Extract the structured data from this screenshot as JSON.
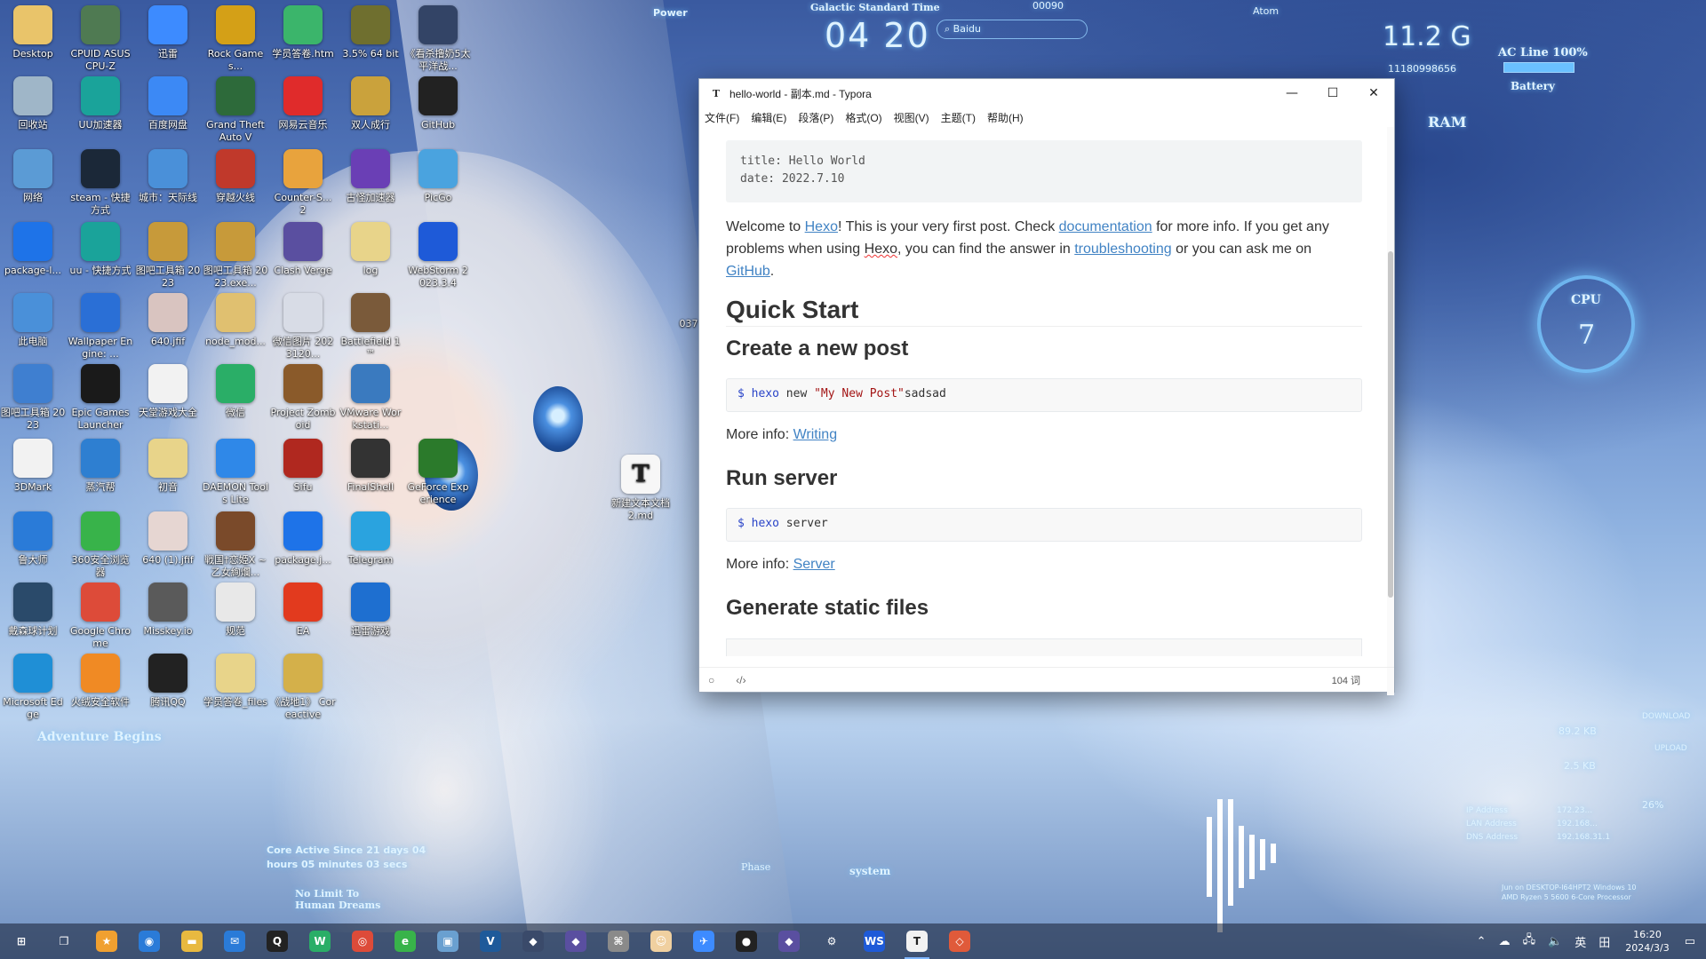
{
  "desktop_icons": [
    {
      "label": "Desktop",
      "color": "#e9c46a"
    },
    {
      "label": "CPUID ASUS CPU-Z",
      "color": "#4f7a52"
    },
    {
      "label": "迅雷",
      "color": "#3d8bff"
    },
    {
      "label": "Rock Games...",
      "color": "#d4a017"
    },
    {
      "label": "学员答卷.htm",
      "color": "#3bb56b"
    },
    {
      "label": "3.5% 64 bit",
      "color": "#6f6f2f"
    },
    {
      "label": "《看杀撸奶5太平洋战...",
      "color": "#334466"
    },
    {
      "label": "回收站",
      "color": "#9fb6c8"
    },
    {
      "label": "UU加速器",
      "color": "#1aa39a"
    },
    {
      "label": "百度网盘",
      "color": "#3c89f5"
    },
    {
      "label": "Grand Theft Auto V",
      "color": "#2d6a3a"
    },
    {
      "label": "网易云音乐",
      "color": "#e02b2b"
    },
    {
      "label": "双人成行",
      "color": "#caa23c"
    },
    {
      "label": "GitHub",
      "color": "#222222"
    },
    {
      "label": "网络",
      "color": "#5b9bd5"
    },
    {
      "label": "steam - 快捷方式",
      "color": "#1b2838"
    },
    {
      "label": "城市：天际线",
      "color": "#4a90d9"
    },
    {
      "label": "穿越火线",
      "color": "#c0392b"
    },
    {
      "label": "Counter-S... 2",
      "color": "#e8a33d"
    },
    {
      "label": "古怪加速器",
      "color": "#6a3fb5"
    },
    {
      "label": "PicGo",
      "color": "#4aa3df"
    },
    {
      "label": "package-l...",
      "color": "#1e73e8"
    },
    {
      "label": "uu - 快捷方式",
      "color": "#1aa39a"
    },
    {
      "label": "图吧工具箱 2023",
      "color": "#c79a3a"
    },
    {
      "label": "图吧工具箱 2023.exe...",
      "color": "#c79a3a"
    },
    {
      "label": "Clash Verge",
      "color": "#5a4fa0"
    },
    {
      "label": "log",
      "color": "#e8d48a"
    },
    {
      "label": "WebStorm 2023.3.4",
      "color": "#1e5ad8"
    },
    {
      "label": "此电脑",
      "color": "#4a90d9"
    },
    {
      "label": "Wallpaper Engine: ...",
      "color": "#2a6fd6"
    },
    {
      "label": "640.jfif",
      "color": "#d9c4c0"
    },
    {
      "label": "node_mod...",
      "color": "#e0c070"
    },
    {
      "label": "微信图片 2023120...",
      "color": "#d8dce6"
    },
    {
      "label": "Battlefield 1 ™",
      "color": "#7a5a3a"
    },
    {
      "label": "",
      "color": "transparent"
    },
    {
      "label": "图吧工具箱 2023",
      "color": "#3f7fd0"
    },
    {
      "label": "Epic Games Launcher",
      "color": "#1a1a1a"
    },
    {
      "label": "天堂游戏大全",
      "color": "#f2f2f2"
    },
    {
      "label": "微信",
      "color": "#2aae67"
    },
    {
      "label": "Project Zomboid",
      "color": "#8a5a2a"
    },
    {
      "label": "VMware Workstati...",
      "color": "#3a7abf"
    },
    {
      "label": "",
      "color": "transparent"
    },
    {
      "label": "3DMark",
      "color": "#f2f2f2"
    },
    {
      "label": "蒸汽帮",
      "color": "#2e7fd1"
    },
    {
      "label": "初音",
      "color": "#e8d48a"
    },
    {
      "label": "DAEMON Tools Lite",
      "color": "#2f88e8"
    },
    {
      "label": "Sifu",
      "color": "#b0281f"
    },
    {
      "label": "FinalShell",
      "color": "#333333"
    },
    {
      "label": "GeForce Experience",
      "color": "#2b7a2b"
    },
    {
      "label": "鲁大师",
      "color": "#2a7bd8"
    },
    {
      "label": "360安全浏览器",
      "color": "#38b34a"
    },
    {
      "label": "640 (1).jfif",
      "color": "#e6d6d2"
    },
    {
      "label": "戦国†恋姫X ~乙女絢爛...",
      "color": "#7a4a2a"
    },
    {
      "label": "package.j...",
      "color": "#1e73e8"
    },
    {
      "label": "Telegram",
      "color": "#2aa3df"
    },
    {
      "label": "",
      "color": "transparent"
    },
    {
      "label": "戴森球计划",
      "color": "#2a4a6a"
    },
    {
      "label": "Google Chrome",
      "color": "#dd4b39"
    },
    {
      "label": "Misskey.io",
      "color": "#5a5a5a"
    },
    {
      "label": "规范",
      "color": "#e8e8e8"
    },
    {
      "label": "EA",
      "color": "#e23a1e"
    },
    {
      "label": "迅雷游戏",
      "color": "#1e6fd0"
    },
    {
      "label": "",
      "color": "transparent"
    },
    {
      "label": "Microsoft Edge",
      "color": "#1f8fd6"
    },
    {
      "label": "火绒安全软件",
      "color": "#f08a24"
    },
    {
      "label": "腾讯QQ",
      "color": "#222222"
    },
    {
      "label": "学员答卷_files",
      "color": "#e8d48a"
    },
    {
      "label": "《战地1》 Coreactive",
      "color": "#d4b04a"
    },
    {
      "label": "",
      "color": "transparent"
    },
    {
      "label": "",
      "color": "transparent"
    }
  ],
  "desktop_file_typora": {
    "label": "新建文本文档 2.md",
    "icon": "T"
  },
  "desktop_partial_label": "037",
  "hud": {
    "power_label": "Power",
    "time_label": "Galactic Standard Time",
    "time_value": "04 20",
    "search_placeholder": "Baidu",
    "counter_value": "00090",
    "atom_label": "Atom",
    "memory_value": "11.2 G",
    "memory_sub": "11180998656",
    "ram_label": "RAM",
    "ac_line": "AC Line 100%",
    "battery_label": "Battery",
    "cpu_label": "CPU",
    "cpu_value": "7",
    "download_label": "DOWNLOAD",
    "download_value": "89.2 KB",
    "upload_label": "UPLOAD",
    "upload_value": "2.5 KB",
    "percent_value": "26%",
    "ip_label": "IP Address",
    "ip_value": "172.23...",
    "lan_label": "LAN Address",
    "lan_value": "192.168...",
    "dns_label": "DNS Address",
    "dns_value": "192.168.31.1",
    "system_label": "system",
    "phase_label": "Phase",
    "core_active": "Core Active Since 21 days 04 hours 05 minutes 03 secs",
    "adventure": "Adventure Begins",
    "no_limit": "No Limit To Human Dreams",
    "sys_info": "Jun on DESKTOP-I64HPT2 Windows 10 AMD Ryzen 5 5600 6-Core Processor"
  },
  "typora": {
    "title": "hello-world - 副本.md - Typora",
    "menu": [
      "文件(F)",
      "编辑(E)",
      "段落(P)",
      "格式(O)",
      "视图(V)",
      "主题(T)",
      "帮助(H)"
    ],
    "frontmatter": [
      "title: Hello World",
      "date: 2022.7.10"
    ],
    "intro": {
      "t1": "Welcome to ",
      "hexo1": "Hexo",
      "t2": "! This is your very first post. Check ",
      "documentation": "documentation",
      "t3": " for more info. If you get any problems when using ",
      "hexo2": "Hexo",
      "t4": ", you can find the answer in ",
      "troubleshooting": "troubleshooting",
      "t5": " or you can ask me on ",
      "github": "GitHub",
      "t6": "."
    },
    "h2_quick_start": "Quick Start",
    "h3_create_post": "Create a new post",
    "code1": {
      "dollar": "$",
      "cmd": "hexo",
      "rest": " new ",
      "str": "\"My New Post\"",
      "tail": "sadsad"
    },
    "more_info_label": "More info: ",
    "link_writing": "Writing",
    "h3_run_server": "Run server",
    "code2": {
      "dollar": "$",
      "cmd": "hexo",
      "rest": " server"
    },
    "link_server": "Server",
    "h3_generate": "Generate static files",
    "word_count": "104 词"
  },
  "taskbar": {
    "items": [
      {
        "name": "start",
        "glyph": "⊞",
        "color": "transparent"
      },
      {
        "name": "task-view",
        "glyph": "❐",
        "color": "transparent"
      },
      {
        "name": "favorites",
        "glyph": "★",
        "color": "#f0a030"
      },
      {
        "name": "bilibili",
        "glyph": "◉",
        "color": "#2a7bd8"
      },
      {
        "name": "file-explorer",
        "glyph": "▬",
        "color": "#e8b940"
      },
      {
        "name": "mail",
        "glyph": "✉",
        "color": "#2a7bd8"
      },
      {
        "name": "qq",
        "glyph": "Q",
        "color": "#222222"
      },
      {
        "name": "wechat",
        "glyph": "W",
        "color": "#2aae67"
      },
      {
        "name": "chrome",
        "glyph": "◎",
        "color": "#dd4b39"
      },
      {
        "name": "360-browser",
        "glyph": "e",
        "color": "#38b34a"
      },
      {
        "name": "bag",
        "glyph": "▣",
        "color": "#6aa0d0"
      },
      {
        "name": "vscode-like",
        "glyph": "V",
        "color": "#1e5a9a"
      },
      {
        "name": "cat",
        "glyph": "◆",
        "color": "#3a4a6a"
      },
      {
        "name": "clash",
        "glyph": "◆",
        "color": "#5a4fa0"
      },
      {
        "name": "trans",
        "glyph": "⌘",
        "color": "#8a8a8a"
      },
      {
        "name": "avatar",
        "glyph": "☺",
        "color": "#f0d0a0"
      },
      {
        "name": "xunlei",
        "glyph": "✈",
        "color": "#3d8bff"
      },
      {
        "name": "github",
        "glyph": "●",
        "color": "#222222"
      },
      {
        "name": "clash-verge",
        "glyph": "◆",
        "color": "#5a4fa0"
      },
      {
        "name": "settings",
        "glyph": "⚙",
        "color": "transparent"
      },
      {
        "name": "webstorm",
        "glyph": "WS",
        "color": "#1e5ad8"
      },
      {
        "name": "typora",
        "glyph": "T",
        "color": "#f2f2f2"
      },
      {
        "name": "git-gui",
        "glyph": "◇",
        "color": "#e05a3a"
      }
    ],
    "tray": {
      "ime": "英",
      "grid": "田"
    },
    "clock_time": "16:20",
    "clock_date": "2024/3/3"
  }
}
